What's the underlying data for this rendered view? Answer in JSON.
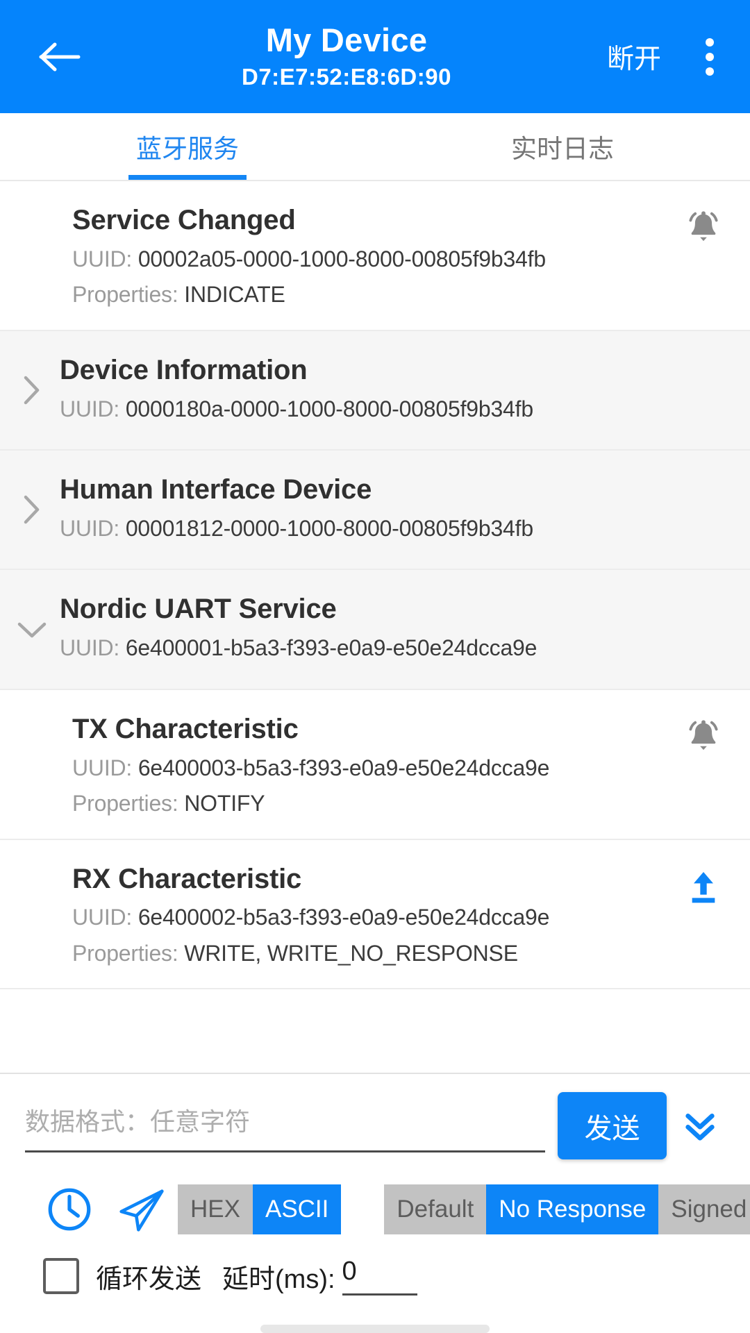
{
  "appbar": {
    "back_icon": "arrow-left-icon",
    "title": "My Device",
    "subtitle": "D7:E7:52:E8:6D:90",
    "action_label": "断开",
    "overflow_icon": "more-vertical-icon",
    "background_color": "#0584fc"
  },
  "tabs": [
    {
      "label": "蓝牙服务",
      "active": true
    },
    {
      "label": "实时日志",
      "active": false
    }
  ],
  "list": [
    {
      "kind": "characteristic",
      "title": "Service Changed",
      "uuid_label": "UUID:",
      "uuid_value": "00002a05-0000-1000-8000-00805f9b34fb",
      "props_label": "Properties:",
      "props_value": "INDICATE",
      "action_icon": "bell-ring-icon",
      "action_color": "#8a8a8a",
      "chevron": ""
    },
    {
      "kind": "service",
      "title": "Device Information",
      "uuid_label": "UUID:",
      "uuid_value": "0000180a-0000-1000-8000-00805f9b34fb",
      "chevron": "chevron-right-icon"
    },
    {
      "kind": "service",
      "title": "Human Interface Device",
      "uuid_label": "UUID:",
      "uuid_value": "00001812-0000-1000-8000-00805f9b34fb",
      "chevron": "chevron-right-icon"
    },
    {
      "kind": "service",
      "title": "Nordic UART Service",
      "uuid_label": "UUID:",
      "uuid_value": "6e400001-b5a3-f393-e0a9-e50e24dcca9e",
      "chevron": "chevron-down-icon"
    },
    {
      "kind": "characteristic",
      "title": "TX Characteristic",
      "uuid_label": "UUID:",
      "uuid_value": "6e400003-b5a3-f393-e0a9-e50e24dcca9e",
      "props_label": "Properties:",
      "props_value": "NOTIFY",
      "action_icon": "bell-ring-icon",
      "action_color": "#8a8a8a",
      "chevron": ""
    },
    {
      "kind": "characteristic",
      "title": "RX Characteristic",
      "uuid_label": "UUID:",
      "uuid_value": "6e400002-b5a3-f393-e0a9-e50e24dcca9e",
      "props_label": "Properties:",
      "props_value": "WRITE, WRITE_NO_RESPONSE",
      "action_icon": "upload-icon",
      "action_color": "#0d85f7",
      "chevron": ""
    }
  ],
  "send": {
    "input_value": "",
    "input_placeholder": "数据格式：任意字符",
    "send_label": "发送",
    "expand_icon": "double-chevron-down-icon"
  },
  "toolbar": {
    "history_icon": "clock-icon",
    "quick_send_icon": "paper-plane-icon",
    "format_options": [
      {
        "label": "HEX",
        "active": false
      },
      {
        "label": "ASCII",
        "active": true
      }
    ],
    "write_options": [
      {
        "label": "Default",
        "active": false
      },
      {
        "label": "No Response",
        "active": true
      },
      {
        "label": "Signed",
        "active": false
      }
    ]
  },
  "loop": {
    "checked": false,
    "label": "循环发送",
    "delay_label": "延时(ms):",
    "delay_value": "0"
  },
  "colors": {
    "accent": "#0d85f7",
    "appbar": "#0584fc",
    "service_row_bg": "#f6f6f6",
    "segment_inactive": "#c2c2c2"
  }
}
